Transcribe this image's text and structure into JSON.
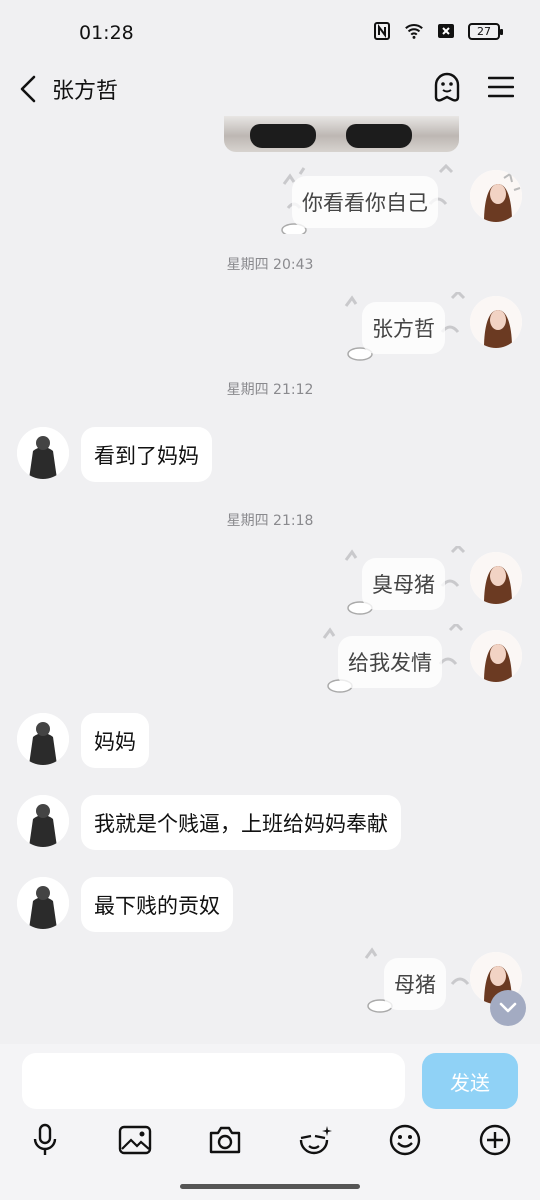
{
  "status_bar": {
    "time": "01:28",
    "battery": "27"
  },
  "header": {
    "contact_name": "张方哲"
  },
  "messages": [
    {
      "type": "timestamp",
      "text": "星期四 20:43"
    },
    {
      "type": "timestamp",
      "text": "星期四 21:12"
    },
    {
      "type": "timestamp",
      "text": "星期四 21:18"
    }
  ],
  "sticker_texts": [
    "你看看你自己",
    "张方哲",
    "臭母猪",
    "给我发情",
    "母猪"
  ],
  "other_texts": [
    "看到了妈妈",
    "妈妈",
    "我就是个贱逼，上班给妈妈奉献",
    "最下贱的贡奴"
  ],
  "input": {
    "value": "",
    "send_label": "发送"
  },
  "tools": [
    "microphone-icon",
    "image-icon",
    "camera-icon",
    "sticker-icon",
    "emoji-icon",
    "add-icon"
  ]
}
